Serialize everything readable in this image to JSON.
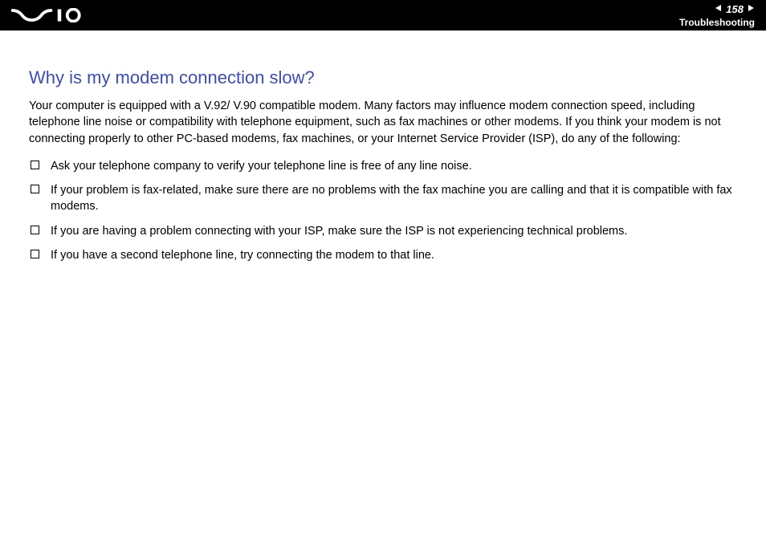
{
  "header": {
    "page_number": "158",
    "section": "Troubleshooting"
  },
  "content": {
    "heading": "Why is my modem connection slow?",
    "intro": "Your computer is equipped with a V.92/ V.90 compatible modem. Many factors may influence modem connection speed, including telephone line noise or compatibility with telephone equipment, such as fax machines or other modems. If you think your modem is not connecting properly to other PC-based modems, fax machines, or your Internet Service Provider (ISP), do any of the following:",
    "bullets": [
      "Ask your telephone company to verify your telephone line is free of any line noise.",
      "If your problem is fax-related, make sure there are no problems with the fax machine you are calling and that it is compatible with fax modems.",
      "If you are having a problem connecting with your ISP, make sure the ISP is not experiencing technical problems.",
      "If you have a second telephone line, try connecting the modem to that line."
    ]
  }
}
